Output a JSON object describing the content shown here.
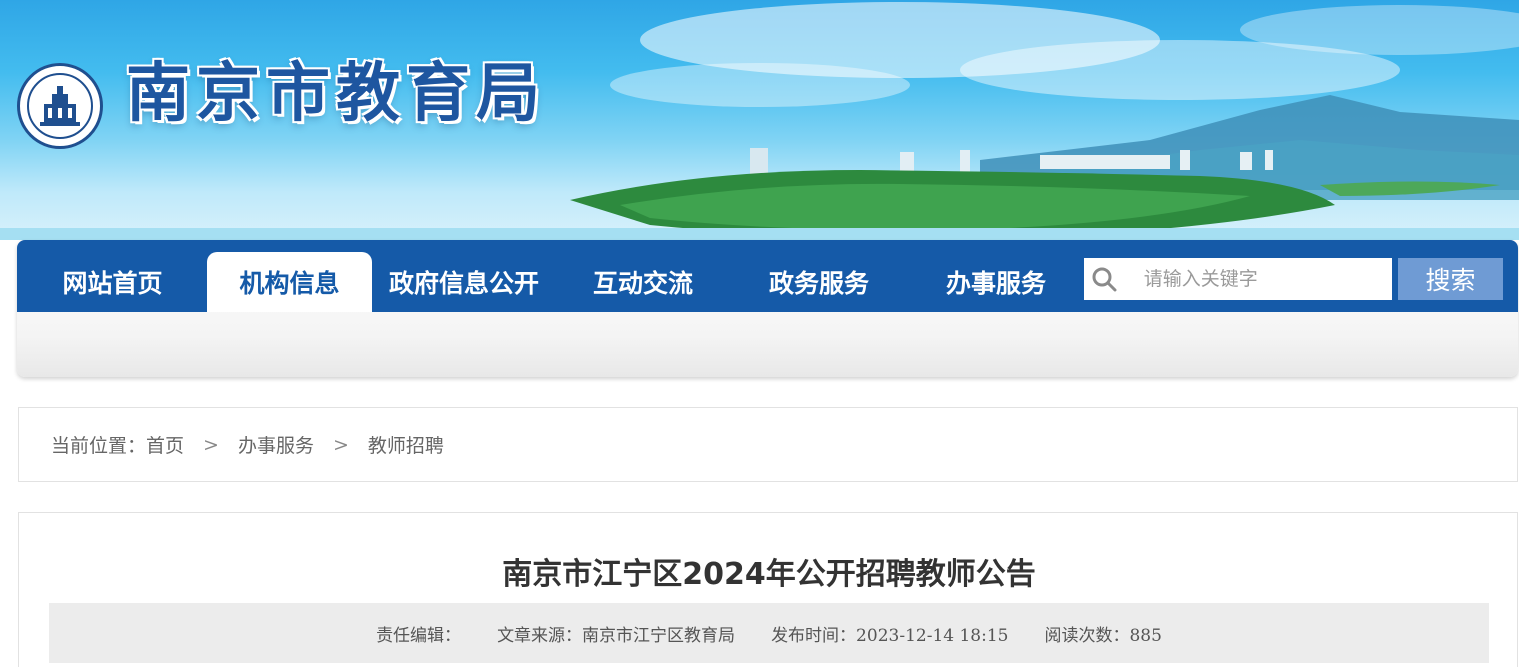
{
  "header": {
    "site_title": "南京市教育局",
    "logo_icon": "nanjing-education-emblem"
  },
  "nav": {
    "items": [
      {
        "label": "网站首页"
      },
      {
        "label": "机构信息",
        "active": true
      },
      {
        "label": "政府信息公开"
      },
      {
        "label": "互动交流"
      },
      {
        "label": "政务服务"
      },
      {
        "label": "办事服务"
      }
    ],
    "search_placeholder": "请输入关键字",
    "search_button": "搜索"
  },
  "breadcrumb": {
    "prefix": "当前位置：",
    "items": [
      "首页",
      "办事服务",
      "教师招聘"
    ],
    "separator": ">"
  },
  "article": {
    "title": "南京市江宁区2024年公开招聘教师公告",
    "meta": {
      "editor": "责任编辑：",
      "source": "文章来源：南京市江宁区教育局",
      "published": "发布时间：2023-12-14 18:15",
      "reads": "阅读次数：885"
    }
  },
  "colors": {
    "brand_blue": "#155aa8",
    "title_blue": "#1e56a0",
    "search_button": "#6f9bd4"
  }
}
